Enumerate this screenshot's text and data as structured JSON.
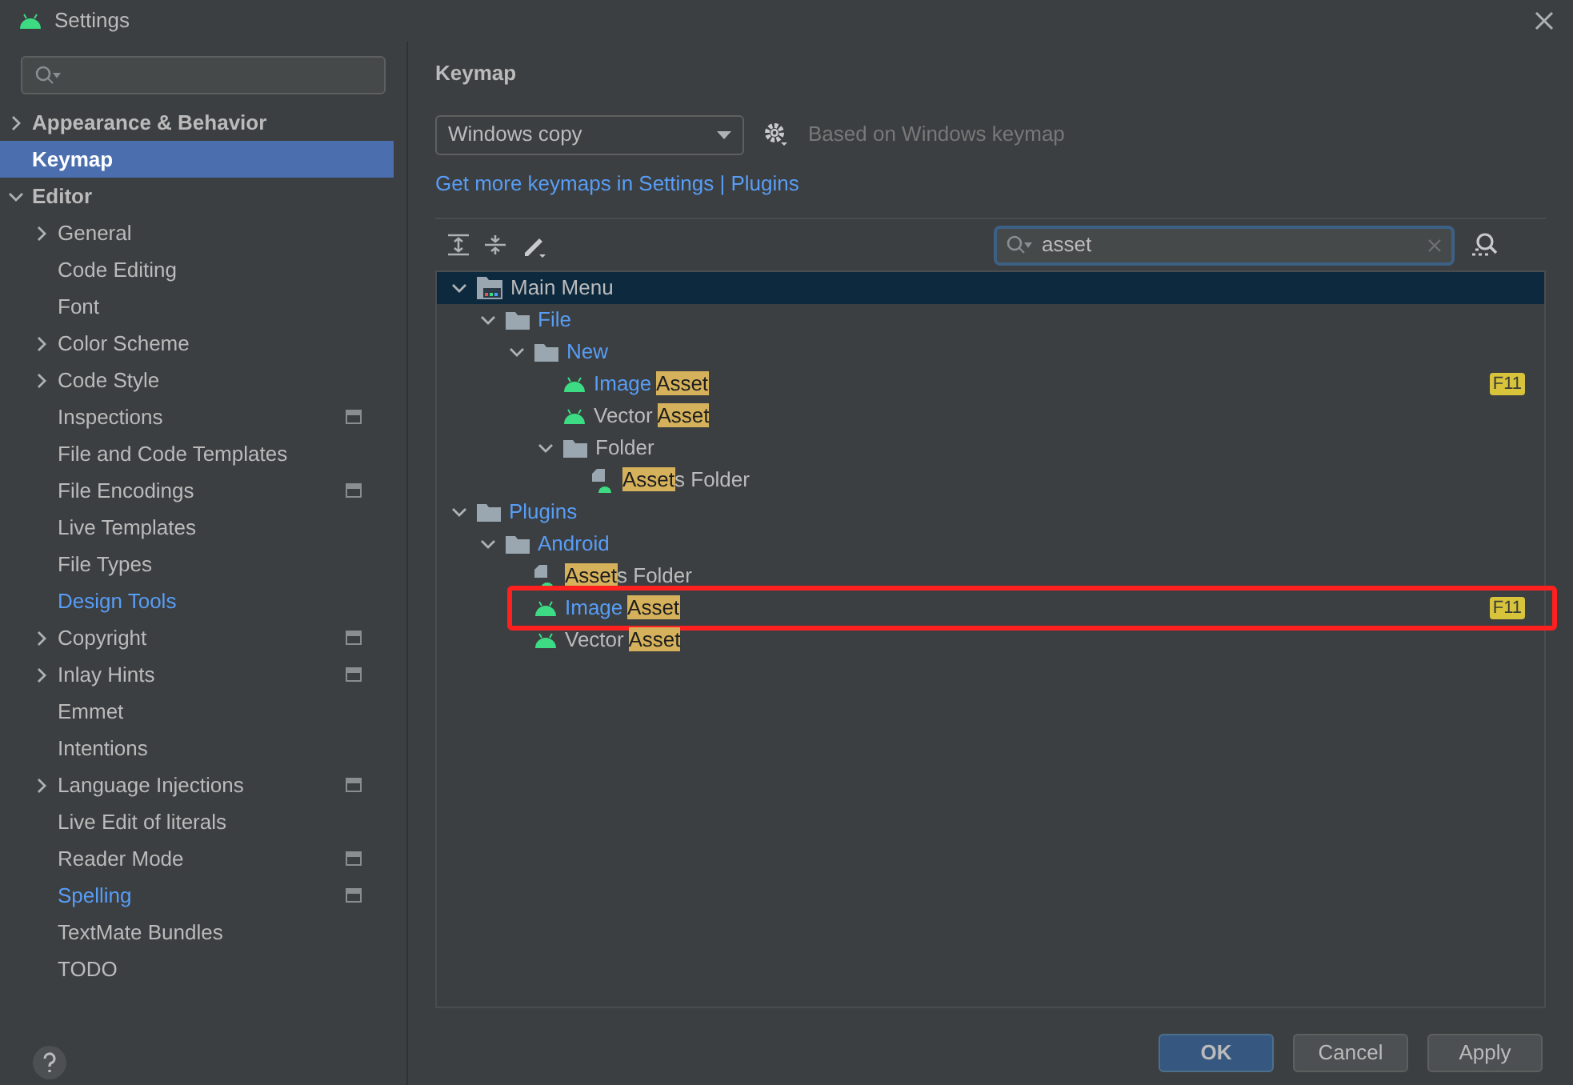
{
  "window": {
    "title": "Settings"
  },
  "sidebar": {
    "items": [
      {
        "label": "Appearance & Behavior",
        "expanded": false,
        "selected": false
      },
      {
        "label": "Keymap",
        "selected": true
      },
      {
        "label": "Editor",
        "expanded": true,
        "selected": false,
        "children": [
          {
            "label": "General",
            "expanded": false,
            "selected": false
          },
          {
            "label": "Code Editing",
            "selected": false
          },
          {
            "label": "Font",
            "selected": false
          },
          {
            "label": "Color Scheme",
            "expanded": false,
            "selected": false
          },
          {
            "label": "Code Style",
            "expanded": false,
            "selected": false
          },
          {
            "label": "Inspections",
            "selected": false,
            "project_scope": true
          },
          {
            "label": "File and Code Templates",
            "selected": false
          },
          {
            "label": "File Encodings",
            "selected": false,
            "project_scope": true
          },
          {
            "label": "Live Templates",
            "selected": false
          },
          {
            "label": "File Types",
            "selected": false
          },
          {
            "label": "Design Tools",
            "selected": false,
            "modified": true
          },
          {
            "label": "Copyright",
            "expanded": false,
            "selected": false,
            "project_scope": true
          },
          {
            "label": "Inlay Hints",
            "expanded": false,
            "selected": false,
            "project_scope": true
          },
          {
            "label": "Emmet",
            "selected": false
          },
          {
            "label": "Intentions",
            "selected": false
          },
          {
            "label": "Language Injections",
            "expanded": false,
            "selected": false,
            "project_scope": true
          },
          {
            "label": "Live Edit of literals",
            "selected": false
          },
          {
            "label": "Reader Mode",
            "selected": false,
            "project_scope": true
          },
          {
            "label": "Spelling",
            "selected": false,
            "modified": true,
            "project_scope": true
          },
          {
            "label": "TextMate Bundles",
            "selected": false
          },
          {
            "label": "TODO",
            "selected": false
          }
        ]
      }
    ]
  },
  "content": {
    "title": "Keymap",
    "keymap_select": {
      "value": "Windows copy"
    },
    "based_on": "Based on Windows keymap",
    "link": "Get more keymaps in Settings | Plugins",
    "search": {
      "value": "asset"
    },
    "tree": [
      {
        "kind": "menu",
        "parts": [
          {
            "text": "Main Menu",
            "match": false
          }
        ],
        "expanded": true,
        "selected": true,
        "children": [
          {
            "kind": "folder",
            "parts": [
              {
                "text": "File",
                "match": false
              }
            ],
            "modified": true,
            "expanded": true,
            "selected": false,
            "children": [
              {
                "kind": "folder",
                "parts": [
                  {
                    "text": "New",
                    "match": false
                  }
                ],
                "modified": true,
                "expanded": true,
                "selected": false,
                "children": [
                  {
                    "kind": "android",
                    "parts": [
                      {
                        "text": "Image ",
                        "match": false
                      },
                      {
                        "text": "Asset",
                        "match": true
                      }
                    ],
                    "modified": true,
                    "selected": false,
                    "shortcut": "F11"
                  },
                  {
                    "kind": "android",
                    "parts": [
                      {
                        "text": "Vector ",
                        "match": false
                      },
                      {
                        "text": "Asset",
                        "match": true
                      }
                    ],
                    "modified": false,
                    "selected": false
                  },
                  {
                    "kind": "folder",
                    "parts": [
                      {
                        "text": "Folder",
                        "match": false
                      }
                    ],
                    "modified": false,
                    "expanded": true,
                    "selected": false,
                    "children": [
                      {
                        "kind": "assets",
                        "parts": [
                          {
                            "text": "Asset",
                            "match": true
                          },
                          {
                            "text": "s Folder",
                            "match": false
                          }
                        ],
                        "modified": false,
                        "selected": false
                      }
                    ]
                  }
                ]
              }
            ]
          }
        ]
      },
      {
        "kind": "folder",
        "parts": [
          {
            "text": "Plugins",
            "match": false
          }
        ],
        "modified": true,
        "expanded": true,
        "selected": false,
        "children": [
          {
            "kind": "folder",
            "parts": [
              {
                "text": "Android",
                "match": false
              }
            ],
            "modified": true,
            "expanded": true,
            "selected": false,
            "children": [
              {
                "kind": "assets",
                "parts": [
                  {
                    "text": "Asset",
                    "match": true
                  },
                  {
                    "text": "s Folder",
                    "match": false
                  }
                ],
                "modified": false,
                "selected": false
              },
              {
                "kind": "android",
                "parts": [
                  {
                    "text": "Image ",
                    "match": false
                  },
                  {
                    "text": "Asset",
                    "match": true
                  }
                ],
                "modified": true,
                "selected": false,
                "shortcut": "F11",
                "annotated": true
              },
              {
                "kind": "android",
                "parts": [
                  {
                    "text": "Vector ",
                    "match": false
                  },
                  {
                    "text": "Asset",
                    "match": true
                  }
                ],
                "modified": false,
                "selected": false
              }
            ]
          }
        ]
      }
    ]
  },
  "buttons": [
    {
      "label": "OK",
      "primary": true
    },
    {
      "label": "Cancel",
      "primary": false
    },
    {
      "label": "Apply",
      "primary": false
    }
  ]
}
